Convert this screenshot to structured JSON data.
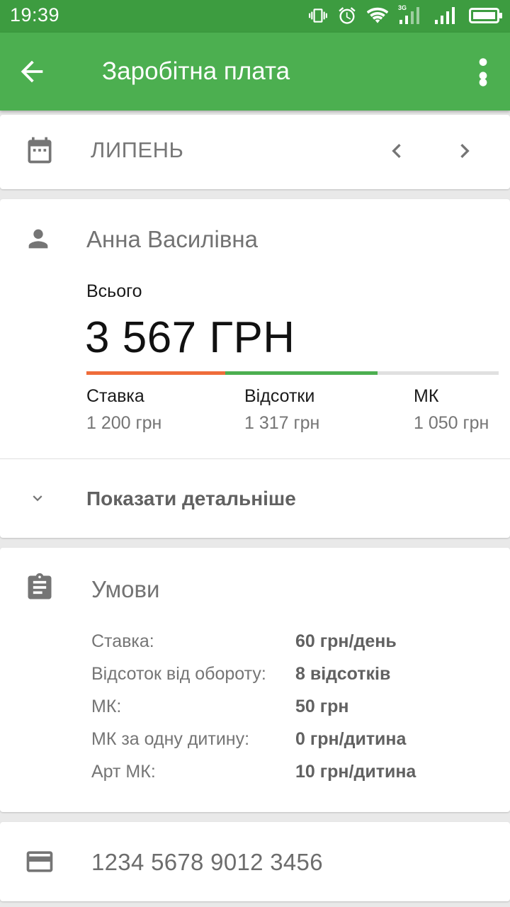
{
  "status_bar": {
    "time": "19:39",
    "network_label": "3G",
    "icons": [
      "vibrate-icon",
      "alarm-icon",
      "wifi-icon",
      "signal-3g-icon",
      "signal-icon",
      "battery-icon"
    ]
  },
  "app_bar": {
    "title": "Заробітна плата",
    "back_icon": "arrow-back-icon",
    "menu_icon": "more-vert-icon",
    "color": "#4caf50",
    "status_color": "#3d9c40"
  },
  "month_card": {
    "month": "ЛИПЕНЬ",
    "icon": "calendar-icon",
    "prev_icon": "chevron-left-icon",
    "next_icon": "chevron-right-icon"
  },
  "employee_card": {
    "icon": "person-icon",
    "name": "Анна Василівна",
    "total_label": "Всього",
    "total_value": "3 567 ГРН",
    "breakdown": [
      {
        "label": "Ставка",
        "value": "1 200 грн",
        "amount": 1200,
        "color": "#ef6c3a"
      },
      {
        "label": "Відсотки",
        "value": "1 317 грн",
        "amount": 1317,
        "color": "#4caf50"
      },
      {
        "label": "МК",
        "value": "1 050 грн",
        "amount": 1050,
        "color": "#e0e0e0"
      }
    ],
    "details_toggle": "Показати детальніше"
  },
  "terms_card": {
    "icon": "clipboard-icon",
    "title": "Умови",
    "rows": [
      {
        "key": "Ставка:",
        "value": "60 грн/день"
      },
      {
        "key": "Відсоток від обороту:",
        "value": "8 відсотків"
      },
      {
        "key": "МК:",
        "value": "50 грн"
      },
      {
        "key": "МК за одну дитину:",
        "value": "0 грн/дитина"
      },
      {
        "key": "Арт МК:",
        "value": "10 грн/дитина"
      }
    ]
  },
  "account_card": {
    "icon": "credit-card-icon",
    "card_number": "1234 5678 9012 3456"
  }
}
